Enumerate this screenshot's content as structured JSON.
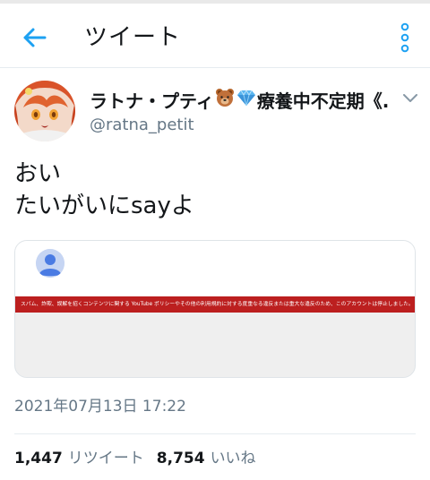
{
  "header": {
    "title": "ツイート",
    "back_icon": "arrow-left-icon",
    "more_icon": "vertical-dots-icon",
    "accent_color": "#1da1f2"
  },
  "tweet": {
    "author": {
      "display_name": "ラトナ・プティ",
      "display_name_suffix": "療養中不定期《...",
      "emojis": [
        "bear-face-icon",
        "gem-stone-icon"
      ],
      "username": "@ratna_petit"
    },
    "text_lines": [
      "おい",
      "たいがいにsayよ"
    ],
    "embed": {
      "banner_text": "スパム、詐欺、誤解を招くコンテンツに関する YouTube ポリシーやその他の利用規約に対する度重なる違反または重大な違反のため、このアカウントは停止しました。",
      "banner_color": "#bc1f1f"
    },
    "timestamp": "2021年07月13日 17:22",
    "stats": {
      "retweets_count": "1,447",
      "retweets_label": "リツイート",
      "likes_count": "8,754",
      "likes_label": "いいね"
    }
  }
}
